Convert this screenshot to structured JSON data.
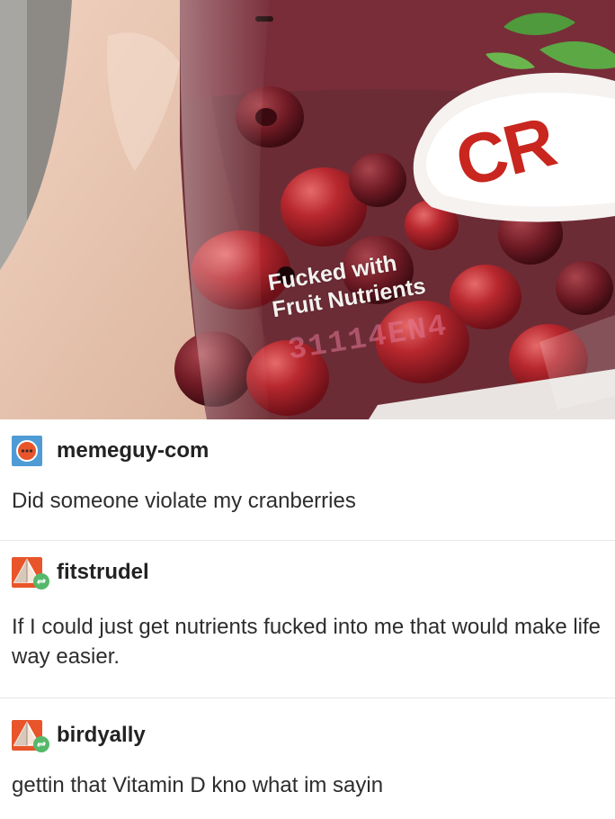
{
  "photo": {
    "bag_line1": "Fucked with",
    "bag_line2": "Fruit Nutrients",
    "lot_code": "31114EN4",
    "brand": "CR"
  },
  "posts": [
    {
      "username": "memeguy-com",
      "text": "Did someone violate my cranberries",
      "avatar_icon": "ellipsis-face-avatar-icon"
    },
    {
      "username": "fitstrudel",
      "text": "If I could just get nutrients fucked into me that would make life way easier.",
      "avatar_icon": "pyramid-avatar-icon",
      "badge_icon": "reblog-icon"
    },
    {
      "username": "birdyally",
      "text": "gettin that Vitamin D kno what im sayin",
      "avatar_icon": "pyramid-avatar-icon",
      "badge_icon": "reblog-icon"
    }
  ],
  "colors": {
    "avatar_blue": "#4f9bd6",
    "avatar_orange": "#e8552a",
    "reblog_green": "#56b86a",
    "brand_red": "#c8261e"
  }
}
